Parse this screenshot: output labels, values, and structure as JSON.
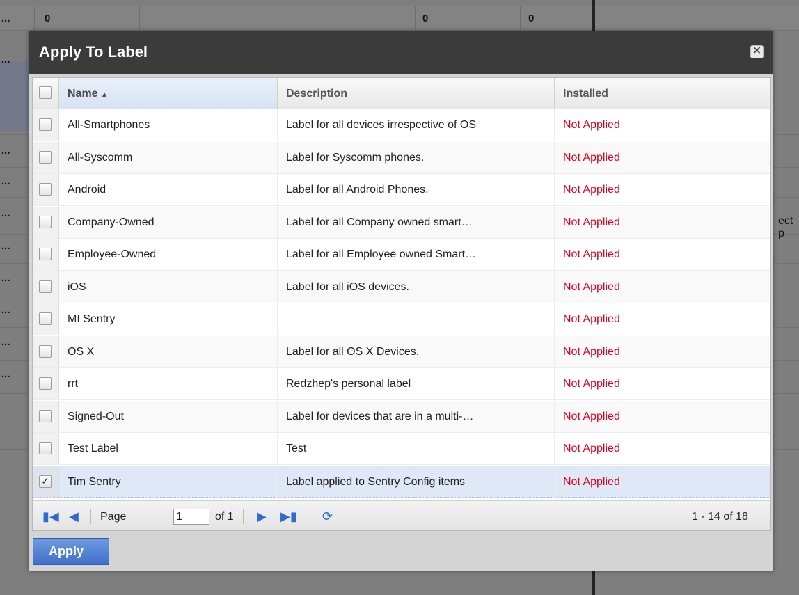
{
  "background": {
    "top_row_values": [
      "0",
      "0",
      "0"
    ],
    "row_ellipsis": "...",
    "side_text": "ect p"
  },
  "dialog": {
    "title": "Apply To Label",
    "close_glyph": "✕",
    "grid": {
      "columns": {
        "name": "Name",
        "description": "Description",
        "installed": "Installed"
      },
      "sort_glyph": "▲",
      "rows": [
        {
          "name": "All-Smartphones",
          "description": "Label for all devices irrespective of OS",
          "installed": "Not Applied",
          "checked": false
        },
        {
          "name": "All-Syscomm",
          "description": "Label for Syscomm phones.",
          "installed": "Not Applied",
          "checked": false
        },
        {
          "name": "Android",
          "description": "Label for all Android Phones.",
          "installed": "Not Applied",
          "checked": false
        },
        {
          "name": "Company-Owned",
          "description": "Label for all Company owned smart…",
          "installed": "Not Applied",
          "checked": false
        },
        {
          "name": "Employee-Owned",
          "description": "Label for all Employee owned Smart…",
          "installed": "Not Applied",
          "checked": false
        },
        {
          "name": "iOS",
          "description": "Label for all iOS devices.",
          "installed": "Not Applied",
          "checked": false
        },
        {
          "name": "MI Sentry",
          "description": "",
          "installed": "Not Applied",
          "checked": false
        },
        {
          "name": "OS X",
          "description": "Label for all OS X Devices.",
          "installed": "Not Applied",
          "checked": false
        },
        {
          "name": "rrt",
          "description": "Redzhep's personal label",
          "installed": "Not Applied",
          "checked": false
        },
        {
          "name": "Signed-Out",
          "description": "Label for devices that are in a multi-…",
          "installed": "Not Applied",
          "checked": false
        },
        {
          "name": "Test Label",
          "description": "Test",
          "installed": "Not Applied",
          "checked": false
        },
        {
          "name": "Tim Sentry",
          "description": "Label applied to Sentry Config items",
          "installed": "Not Applied",
          "checked": true
        }
      ]
    },
    "pager": {
      "first_icon": "first-page-icon",
      "prev_icon": "prev-page-icon",
      "next_icon": "next-page-icon",
      "last_icon": "last-page-icon",
      "refresh_icon": "refresh-icon",
      "page_label": "Page",
      "page_value": "1",
      "of_label": "of 1",
      "count": "1 - 14 of 18"
    },
    "apply_label": "Apply"
  },
  "colors": {
    "installed_status": "#e0001b",
    "title_bar": "#3b3b3b",
    "apply_button": "#4a78cf"
  }
}
